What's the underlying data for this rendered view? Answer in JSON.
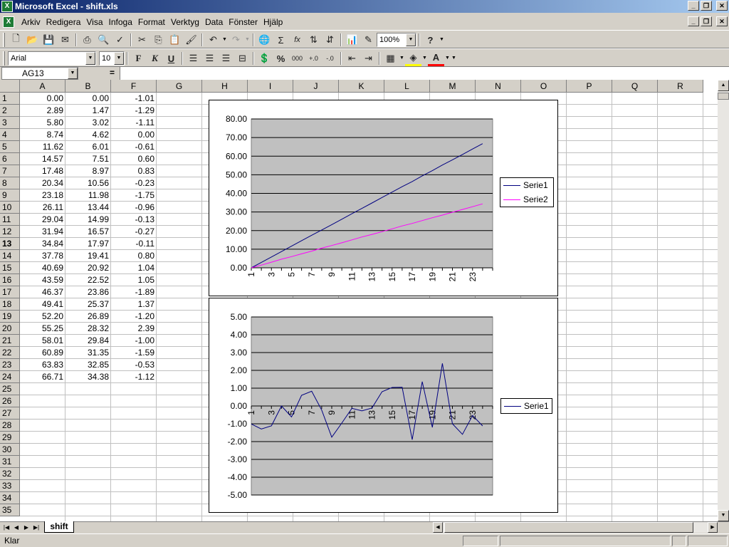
{
  "window": {
    "title": "Microsoft Excel - shift.xls"
  },
  "menu": [
    "Arkiv",
    "Redigera",
    "Visa",
    "Infoga",
    "Format",
    "Verktyg",
    "Data",
    "Fönster",
    "Hjälp"
  ],
  "toolbar": {
    "zoom": "100%",
    "font_name": "Arial",
    "font_size": "10",
    "bold": "F",
    "italic": "K",
    "underline": "U",
    "percent": "%",
    "thousands": "000",
    "sum": "Σ",
    "function": "fx",
    "help": "?"
  },
  "formula_bar": {
    "name_box": "AG13",
    "equals": "="
  },
  "sheet": {
    "columns": [
      "A",
      "B",
      "F",
      "G",
      "H",
      "I",
      "J",
      "K",
      "L",
      "M",
      "N",
      "O",
      "P",
      "Q",
      "R"
    ],
    "active_row": 13,
    "rows": [
      {
        "a": "0.00",
        "b": "0.00",
        "f": "-1.01"
      },
      {
        "a": "2.89",
        "b": "1.47",
        "f": "-1.29"
      },
      {
        "a": "5.80",
        "b": "3.02",
        "f": "-1.11"
      },
      {
        "a": "8.74",
        "b": "4.62",
        "f": "0.00"
      },
      {
        "a": "11.62",
        "b": "6.01",
        "f": "-0.61"
      },
      {
        "a": "14.57",
        "b": "7.51",
        "f": "0.60"
      },
      {
        "a": "17.48",
        "b": "8.97",
        "f": "0.83"
      },
      {
        "a": "20.34",
        "b": "10.56",
        "f": "-0.23"
      },
      {
        "a": "23.18",
        "b": "11.98",
        "f": "-1.75"
      },
      {
        "a": "26.11",
        "b": "13.44",
        "f": "-0.96"
      },
      {
        "a": "29.04",
        "b": "14.99",
        "f": "-0.13"
      },
      {
        "a": "31.94",
        "b": "16.57",
        "f": "-0.27"
      },
      {
        "a": "34.84",
        "b": "17.97",
        "f": "-0.11"
      },
      {
        "a": "37.78",
        "b": "19.41",
        "f": "0.80"
      },
      {
        "a": "40.69",
        "b": "20.92",
        "f": "1.04"
      },
      {
        "a": "43.59",
        "b": "22.52",
        "f": "1.05"
      },
      {
        "a": "46.37",
        "b": "23.86",
        "f": "-1.89"
      },
      {
        "a": "49.41",
        "b": "25.37",
        "f": "1.37"
      },
      {
        "a": "52.20",
        "b": "26.89",
        "f": "-1.20"
      },
      {
        "a": "55.25",
        "b": "28.32",
        "f": "2.39"
      },
      {
        "a": "58.01",
        "b": "29.84",
        "f": "-1.00"
      },
      {
        "a": "60.89",
        "b": "31.35",
        "f": "-1.59"
      },
      {
        "a": "63.83",
        "b": "32.85",
        "f": "-0.53"
      },
      {
        "a": "66.71",
        "b": "34.38",
        "f": "-1.12"
      }
    ],
    "tab_name": "shift"
  },
  "chart_data": [
    {
      "type": "line",
      "x": [
        1,
        2,
        3,
        4,
        5,
        6,
        7,
        8,
        9,
        10,
        11,
        12,
        13,
        14,
        15,
        16,
        17,
        18,
        19,
        20,
        21,
        22,
        23,
        24
      ],
      "x_tick_labels": [
        "1",
        "3",
        "5",
        "7",
        "9",
        "11",
        "13",
        "15",
        "17",
        "19",
        "21",
        "23"
      ],
      "y_tick_labels": [
        "80.00",
        "70.00",
        "60.00",
        "50.00",
        "40.00",
        "30.00",
        "20.00",
        "10.00",
        "0.00"
      ],
      "ylim": [
        0,
        80
      ],
      "grid": true,
      "legend": "right",
      "series": [
        {
          "name": "Serie1",
          "color": "#000080",
          "values": [
            0.0,
            2.89,
            5.8,
            8.74,
            11.62,
            14.57,
            17.48,
            20.34,
            23.18,
            26.11,
            29.04,
            31.94,
            34.84,
            37.78,
            40.69,
            43.59,
            46.37,
            49.41,
            52.2,
            55.25,
            58.01,
            60.89,
            63.83,
            66.71
          ]
        },
        {
          "name": "Serie2",
          "color": "#ff00ff",
          "values": [
            0.0,
            1.47,
            3.02,
            4.62,
            6.01,
            7.51,
            8.97,
            10.56,
            11.98,
            13.44,
            14.99,
            16.57,
            17.97,
            19.41,
            20.92,
            22.52,
            23.86,
            25.37,
            26.89,
            28.32,
            29.84,
            31.35,
            32.85,
            34.38
          ]
        }
      ]
    },
    {
      "type": "line",
      "x": [
        1,
        2,
        3,
        4,
        5,
        6,
        7,
        8,
        9,
        10,
        11,
        12,
        13,
        14,
        15,
        16,
        17,
        18,
        19,
        20,
        21,
        22,
        23,
        24
      ],
      "x_tick_labels": [
        "1",
        "3",
        "5",
        "7",
        "9",
        "11",
        "13",
        "15",
        "17",
        "19",
        "21",
        "23"
      ],
      "y_tick_labels": [
        "5.00",
        "4.00",
        "3.00",
        "2.00",
        "1.00",
        "0.00",
        "-1.00",
        "-2.00",
        "-3.00",
        "-4.00",
        "-5.00"
      ],
      "ylim": [
        -5,
        5
      ],
      "grid": true,
      "legend": "right",
      "series": [
        {
          "name": "Serie1",
          "color": "#000080",
          "values": [
            -1.01,
            -1.29,
            -1.11,
            0.0,
            -0.61,
            0.6,
            0.83,
            -0.23,
            -1.75,
            -0.96,
            -0.13,
            -0.27,
            -0.11,
            0.8,
            1.04,
            1.05,
            -1.89,
            1.37,
            -1.2,
            2.39,
            -1.0,
            -1.59,
            -0.53,
            -1.12
          ]
        }
      ]
    }
  ],
  "status": {
    "text": "Klar"
  },
  "colors": {
    "plot_area": "#c0c0c0",
    "titlebar_start": "#0a246a",
    "titlebar_end": "#a6caf0",
    "excel_green": "#1e7c35"
  }
}
